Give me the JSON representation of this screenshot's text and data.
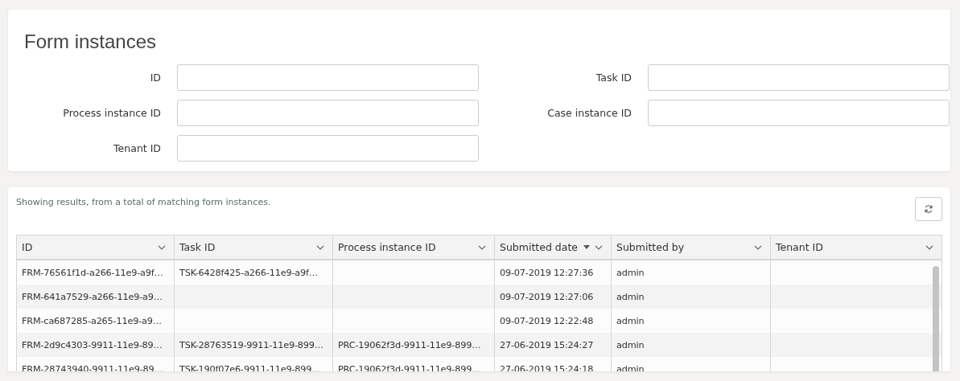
{
  "filter_panel": {
    "title": "Form instances",
    "fields": [
      {
        "label": "ID"
      },
      {
        "label": "Task ID"
      },
      {
        "label": "Process instance ID"
      },
      {
        "label": "Case instance ID"
      },
      {
        "label": "Tenant ID"
      }
    ]
  },
  "results": {
    "summary": "Showing results, from a total of matching form instances.",
    "table": {
      "columns": [
        {
          "label": "ID",
          "sorted": false
        },
        {
          "label": "Task ID",
          "sorted": false
        },
        {
          "label": "Process instance ID",
          "sorted": false
        },
        {
          "label": "Submitted date",
          "sorted": true
        },
        {
          "label": "Submitted by",
          "sorted": false
        },
        {
          "label": "Tenant ID",
          "sorted": false
        }
      ],
      "rows": [
        [
          "FRM-76561f1d-a266-11e9-a9f…",
          "TSK-6428f425-a266-11e9-a9f…",
          null,
          "09-07-2019 12:27:36",
          "admin",
          null
        ],
        [
          "FRM-641a7529-a266-11e9-a9…",
          null,
          null,
          "09-07-2019 12:27:06",
          "admin",
          null
        ],
        [
          "FRM-ca687285-a265-11e9-a9…",
          null,
          null,
          "09-07-2019 12:22:48",
          "admin",
          null
        ],
        [
          "FRM-2d9c4303-9911-11e9-89…",
          "TSK-28763519-9911-11e9-899…",
          "PRC-19062f3d-9911-11e9-899…",
          "27-06-2019 15:24:27",
          "admin",
          null
        ],
        [
          "FRM-28743940-9911-11e9-89…",
          "TSK-190f07e6-9911-11e9-899…",
          "PRC-19062f3d-9911-11e9-899…",
          "27-06-2019 15:24:18",
          "admin",
          null
        ]
      ]
    }
  }
}
